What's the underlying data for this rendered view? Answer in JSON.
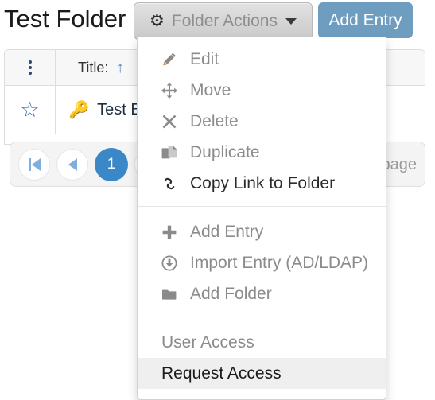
{
  "header": {
    "title": "Test Folder",
    "folder_actions": {
      "label": "Folder Actions",
      "icon": "gear-icon",
      "caret": "chevron-down-icon"
    },
    "add_entry": {
      "label": "Add Entry"
    }
  },
  "table": {
    "columns": [
      {
        "name": "row-menu",
        "label": "",
        "icon": "vertical-ellipsis-icon"
      },
      {
        "name": "title",
        "label": "Title:",
        "sort": "ascending",
        "sort_icon": "arrow-up-icon"
      }
    ],
    "rows": [
      {
        "favorite_icon": "star-outline-icon",
        "entry_icon": "key-icon",
        "entry_icon_glyph": "🔑",
        "title": "Test E"
      }
    ]
  },
  "pagination": {
    "first_label": "",
    "prev_label": "",
    "current_page": "1",
    "page_label": "page"
  },
  "menu": {
    "groups": [
      {
        "name": "folder-operations",
        "items": [
          {
            "label": "Edit",
            "icon": "pencil-icon",
            "state": "muted"
          },
          {
            "label": "Move",
            "icon": "move-arrows-icon",
            "state": "muted"
          },
          {
            "label": "Delete",
            "icon": "times-icon",
            "state": "muted"
          },
          {
            "label": "Duplicate",
            "icon": "copy-icon",
            "state": "muted"
          },
          {
            "label": "Copy Link to Folder",
            "icon": "link-icon",
            "state": "strong"
          }
        ]
      },
      {
        "name": "create-operations",
        "items": [
          {
            "label": "Add Entry",
            "icon": "plus-icon",
            "state": "muted"
          },
          {
            "label": "Import Entry (AD/LDAP)",
            "icon": "download-circle-icon",
            "state": "muted"
          },
          {
            "label": "Add Folder",
            "icon": "folder-icon",
            "state": "muted"
          }
        ]
      },
      {
        "name": "access-operations",
        "items": [
          {
            "label": "User Access",
            "icon": "",
            "state": "muted"
          },
          {
            "label": "Request Access",
            "icon": "",
            "state": "hovered"
          }
        ]
      }
    ]
  },
  "colors": {
    "accent_blue": "#3b88c8",
    "button_blue": "#6f9dc0",
    "text_muted": "#8b8b8b",
    "text_dark": "#2b2b2b",
    "hover_bg": "#efefef",
    "card_border": "#dddddd"
  }
}
